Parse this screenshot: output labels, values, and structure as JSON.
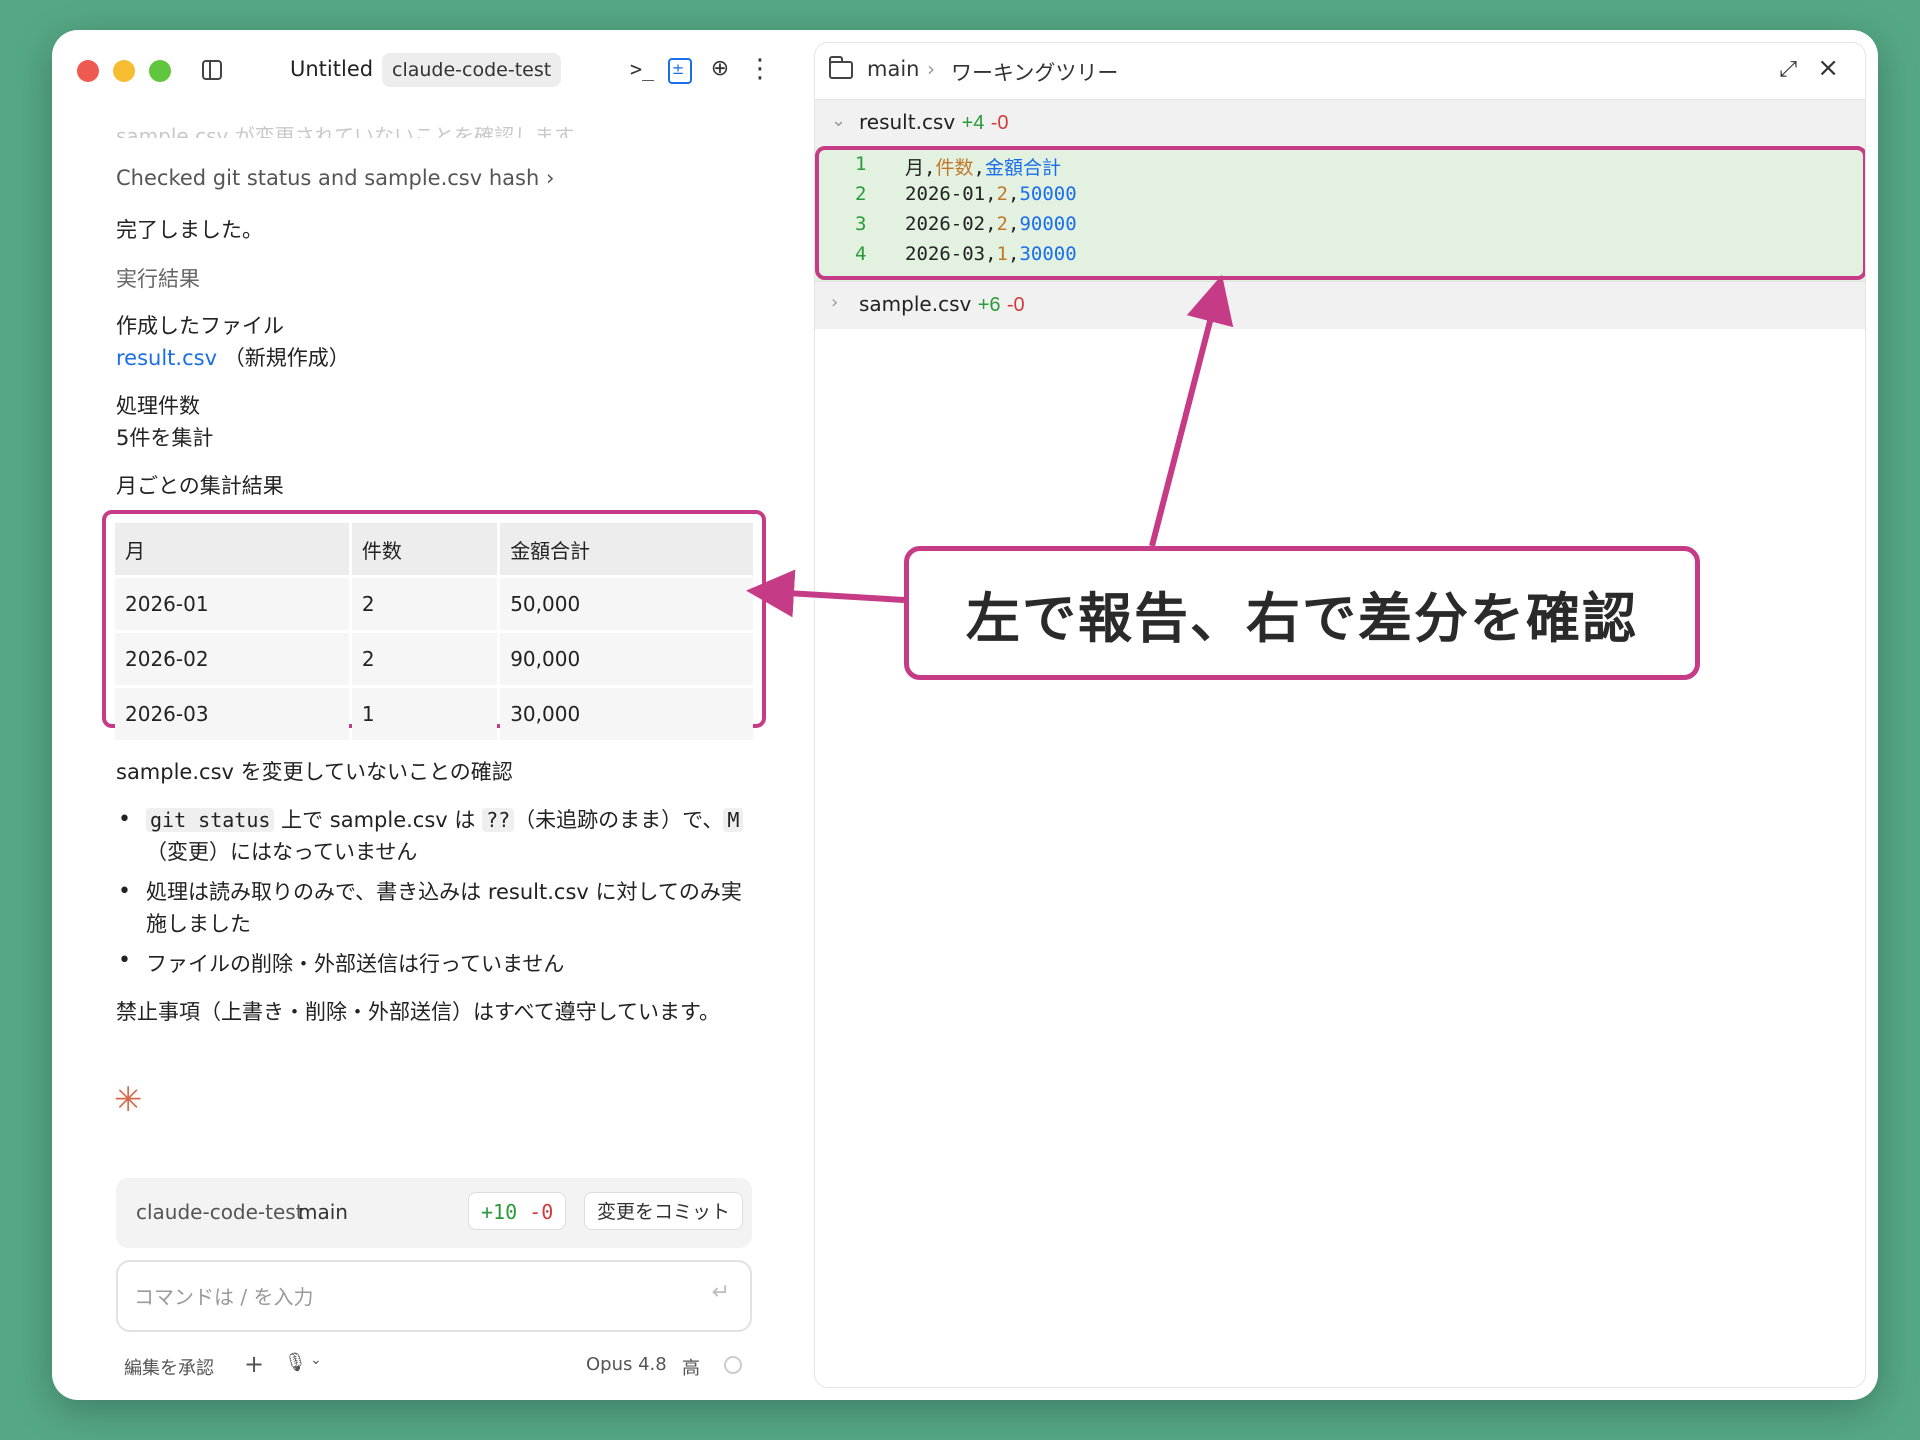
{
  "titlebar": {
    "title": "Untitled",
    "branch_chip": "claude-code-test",
    "icons": [
      "sidebar-icon",
      "terminal-icon",
      "diff-icon",
      "globe-icon",
      "more-icon"
    ]
  },
  "chat": {
    "faded_text": "sample.csv が変更されていないことを確認します。",
    "tool_line": "Checked git status and sample.csv hash",
    "done": "完了しました。",
    "results_heading": "実行結果",
    "created_label": "作成したファイル",
    "created_file": "result.csv",
    "created_note": "（新規作成）",
    "count_label": "処理件数",
    "count_value": "5件を集計",
    "monthly_label": "月ごとの集計結果",
    "table": {
      "headers": [
        "月",
        "件数",
        "金額合計"
      ],
      "rows": [
        [
          "2026-01",
          "2",
          "50,000"
        ],
        [
          "2026-02",
          "2",
          "90,000"
        ],
        [
          "2026-03",
          "1",
          "30,000"
        ]
      ]
    },
    "verify_heading": "sample.csv を変更していないことの確認",
    "bullets": {
      "b1_code1": "git status",
      "b1_text1": " 上で sample.csv は ",
      "b1_code2": "??",
      "b1_text2": "（未追跡のまま）で、",
      "b1_code3": "M",
      "b1_text3": "（変更）にはなっていません",
      "b2": "処理は読み取りのみで、書き込みは result.csv に対してのみ実施しました",
      "b3": "ファイルの削除・外部送信は行っていません"
    },
    "closing": "禁止事項（上書き・削除・外部送信）はすべて遵守しています。"
  },
  "commit_bar": {
    "repo": "claude-code-test",
    "branch": "main",
    "added": "+10",
    "removed": "-0",
    "commit_label": "変更をコミット"
  },
  "input": {
    "placeholder": "コマンドは / を入力"
  },
  "footer": {
    "accept_edits": "編集を承認",
    "model": "Opus 4.8",
    "effort": "高"
  },
  "right_pane": {
    "branch": "main",
    "separator": "›",
    "tree": "ワーキングツリー",
    "files": [
      {
        "name": "result.csv",
        "added": "+4",
        "removed": "-0",
        "expanded": true
      },
      {
        "name": "sample.csv",
        "added": "+6",
        "removed": "-0",
        "expanded": false
      }
    ],
    "diff_lines": [
      {
        "n": "1",
        "a": "月",
        "b": "件数",
        "c": "金額合計"
      },
      {
        "n": "2",
        "a": "2026-01",
        "b": "2",
        "c": "50000"
      },
      {
        "n": "3",
        "a": "2026-02",
        "b": "2",
        "c": "90000"
      },
      {
        "n": "4",
        "a": "2026-03",
        "b": "1",
        "c": "30000"
      }
    ]
  },
  "annotation": {
    "callout": "左で報告、右で差分を確認",
    "accent_color": "#c63b86"
  }
}
